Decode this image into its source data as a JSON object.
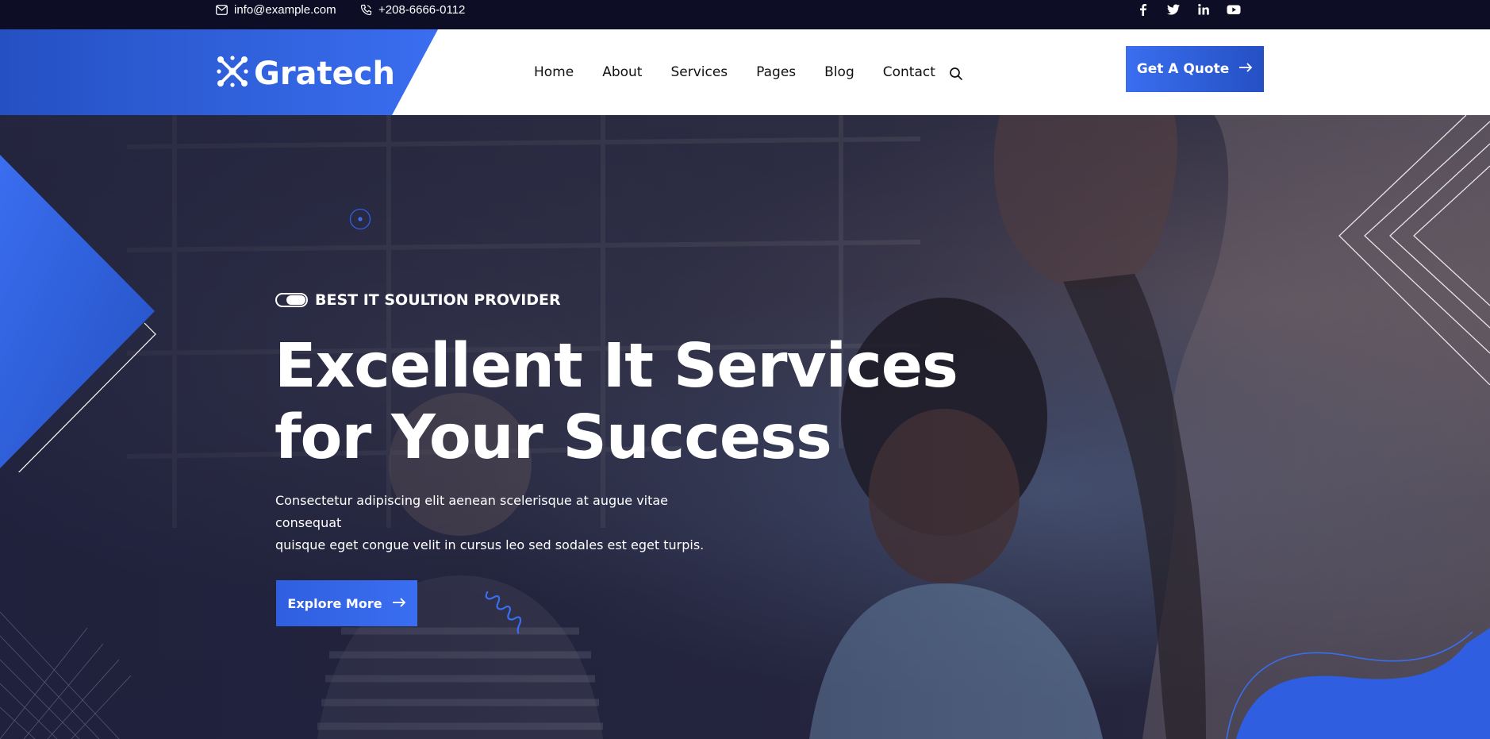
{
  "topbar": {
    "email": "info@example.com",
    "phone": "+208-6666-0112",
    "socials": [
      "facebook-icon",
      "twitter-icon",
      "linkedin-icon",
      "youtube-icon"
    ]
  },
  "header": {
    "logo_text": "Gratech",
    "nav": [
      "Home",
      "About",
      "Services",
      "Pages",
      "Blog",
      "Contact"
    ],
    "cta_label": "Get A Quote"
  },
  "hero": {
    "tagline": "BEST IT SOULTION PROVIDER",
    "headline_line1": "Excellent It Services",
    "headline_line2": "for Your Success",
    "subtext_line1": "Consectetur adipiscing elit aenean scelerisque at augue vitae consequat",
    "subtext_line2": "quisque eget congue velit in cursus leo sed sodales est eget turpis.",
    "button_label": "Explore More"
  },
  "colors": {
    "accent": "#3a6ef0",
    "accent_dark": "#2450c2",
    "topbar_bg": "#0e0d26"
  }
}
